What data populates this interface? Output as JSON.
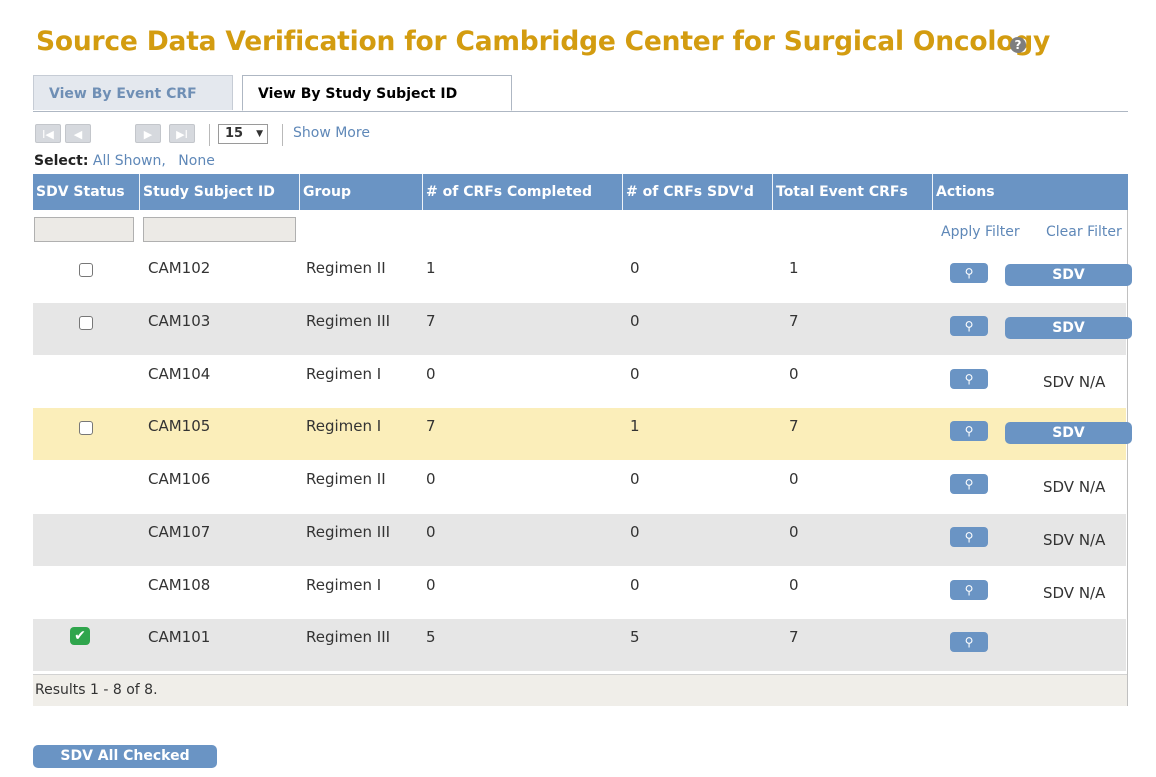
{
  "page_title": "Source Data Verification for Cambridge Center for Surgical Oncology",
  "help_glyph": "?",
  "tabs": [
    {
      "label": "View By Event CRF",
      "active": false
    },
    {
      "label": "View By Study Subject ID",
      "active": true
    }
  ],
  "toolbar": {
    "first_glyph": "I◀",
    "prev_glyph": "◀",
    "next_glyph": "▶",
    "last_glyph": "▶I",
    "page_size": "15",
    "show_more": "Show More"
  },
  "select": {
    "label": "Select:",
    "all_shown": "All Shown,",
    "none": "None"
  },
  "columns": [
    "SDV Status",
    "Study Subject ID",
    "Group",
    "# of CRFs Completed",
    "# of CRFs SDV'd",
    "Total Event CRFs",
    "Actions"
  ],
  "filters": {
    "apply": "Apply Filter",
    "clear": "Clear Filter"
  },
  "rows": [
    {
      "status": "unchecked",
      "id": "CAM102",
      "group": "Regimen II",
      "completed": "1",
      "sdvd": "0",
      "total": "1",
      "action": "SDV",
      "highlight": false
    },
    {
      "status": "unchecked",
      "id": "CAM103",
      "group": "Regimen III",
      "completed": "7",
      "sdvd": "0",
      "total": "7",
      "action": "SDV",
      "highlight": false
    },
    {
      "status": "none",
      "id": "CAM104",
      "group": "Regimen I",
      "completed": "0",
      "sdvd": "0",
      "total": "0",
      "action": "SDV N/A",
      "highlight": false
    },
    {
      "status": "unchecked",
      "id": "CAM105",
      "group": "Regimen I",
      "completed": "7",
      "sdvd": "1",
      "total": "7",
      "action": "SDV",
      "highlight": true
    },
    {
      "status": "none",
      "id": "CAM106",
      "group": "Regimen II",
      "completed": "0",
      "sdvd": "0",
      "total": "0",
      "action": "SDV N/A",
      "highlight": false
    },
    {
      "status": "none",
      "id": "CAM107",
      "group": "Regimen III",
      "completed": "0",
      "sdvd": "0",
      "total": "0",
      "action": "SDV N/A",
      "highlight": false
    },
    {
      "status": "none",
      "id": "CAM108",
      "group": "Regimen I",
      "completed": "0",
      "sdvd": "0",
      "total": "0",
      "action": "SDV N/A",
      "highlight": false
    },
    {
      "status": "checked",
      "id": "CAM101",
      "group": "Regimen III",
      "completed": "5",
      "sdvd": "5",
      "total": "7",
      "action": "",
      "highlight": false
    }
  ],
  "results_text": "Results 1 - 8 of 8.",
  "sdv_all_label": "SDV All Checked",
  "colors": {
    "title": "#d39c10",
    "header": "#6a94c4",
    "link": "#5f88b8",
    "row_alt": "#e6e6e6",
    "row_highlight": "#fbeeba",
    "check_green": "#2fa54c"
  }
}
